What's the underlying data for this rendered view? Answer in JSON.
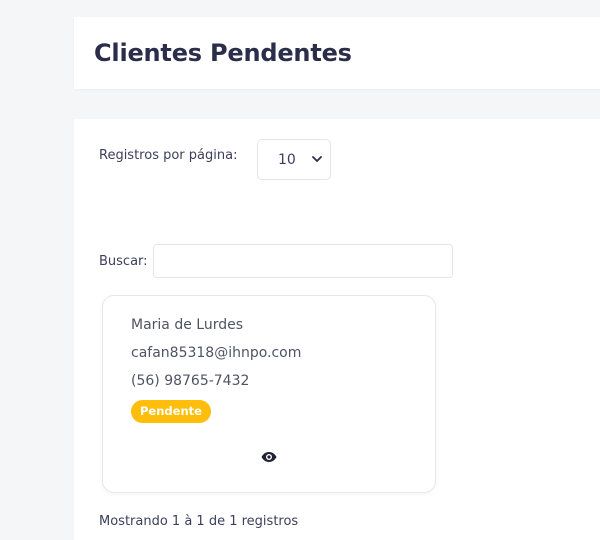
{
  "header": {
    "title": "Clientes Pendentes"
  },
  "controls": {
    "per_page_label": "Registros por página:",
    "per_page_value": "10",
    "search_label": "Buscar:",
    "search_value": "",
    "search_placeholder": ""
  },
  "clients": [
    {
      "name": "Maria de Lurdes",
      "email": "cafan85318@ihnpo.com",
      "phone": "(56) 98765-7432",
      "status": "Pendente",
      "view_icon": "eye-icon"
    }
  ],
  "footer": {
    "info": "Mostrando 1 à 1 de 1 registros"
  },
  "colors": {
    "status_pending": "#ffbe0b",
    "title": "#2b2e4a",
    "background": "#f5f6f8"
  }
}
